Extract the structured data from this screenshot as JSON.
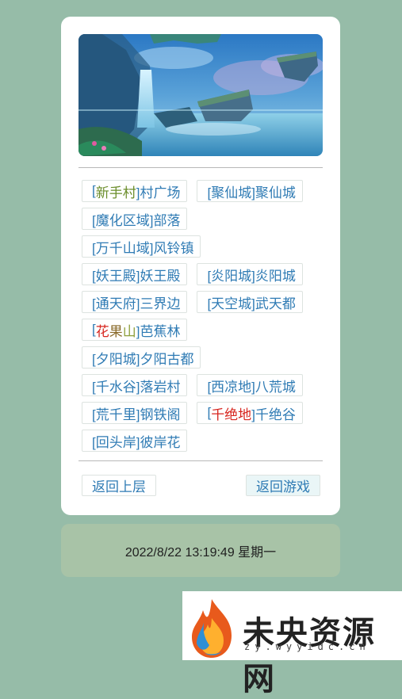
{
  "locations": [
    [
      {
        "id": "xinshoucun",
        "parts": [
          {
            "t": "[",
            "c": "bracket"
          },
          {
            "t": "新手村",
            "c": "c-green"
          },
          {
            "t": "]村广场",
            "c": "bracket"
          }
        ]
      },
      {
        "id": "juxiancheng",
        "parts": [
          {
            "t": "[聚仙城]聚仙城",
            "c": "bracket"
          }
        ]
      }
    ],
    [
      {
        "id": "mohuaquyu",
        "parts": [
          {
            "t": "[魔化区域]部落",
            "c": "bracket"
          }
        ]
      }
    ],
    [
      {
        "id": "wanqianshancheng",
        "parts": [
          {
            "t": "[万千山域]风铃镇",
            "c": "bracket"
          }
        ]
      }
    ],
    [
      {
        "id": "yaowangdian",
        "parts": [
          {
            "t": "[妖王殿]妖王殿",
            "c": "bracket"
          }
        ]
      },
      {
        "id": "yanyangcheng",
        "parts": [
          {
            "t": "[炎阳城]炎阳城",
            "c": "bracket"
          }
        ]
      }
    ],
    [
      {
        "id": "tongtianfu",
        "parts": [
          {
            "t": "[通天府]三界边",
            "c": "bracket"
          }
        ]
      },
      {
        "id": "tiankongcheng",
        "parts": [
          {
            "t": "[天空城]武天都",
            "c": "bracket"
          }
        ]
      }
    ],
    [
      {
        "id": "huaguoshan",
        "parts": [
          {
            "t": "[",
            "c": "bracket"
          },
          {
            "t": "花",
            "c": "c-red"
          },
          {
            "t": "果",
            "c": "c-brown"
          },
          {
            "t": "山",
            "c": "c-olive"
          },
          {
            "t": "]芭蕉林",
            "c": "bracket"
          }
        ]
      }
    ],
    [
      {
        "id": "xiyangcheng",
        "parts": [
          {
            "t": "[夕阳城]夕阳古都",
            "c": "bracket"
          }
        ]
      }
    ],
    [
      {
        "id": "qianshuigu",
        "parts": [
          {
            "t": "[千水谷]落岩村",
            "c": "bracket"
          }
        ]
      },
      {
        "id": "xiliangdi",
        "parts": [
          {
            "t": "[西凉地]八荒城",
            "c": "bracket"
          }
        ]
      }
    ],
    [
      {
        "id": "huangqianli",
        "parts": [
          {
            "t": "[荒千里]钢铁阁",
            "c": "bracket"
          }
        ]
      },
      {
        "id": "qianjuedi",
        "parts": [
          {
            "t": "[",
            "c": "bracket"
          },
          {
            "t": "千绝地",
            "c": "c-red"
          },
          {
            "t": "]千绝谷",
            "c": "bracket"
          }
        ]
      }
    ],
    [
      {
        "id": "huitouan",
        "parts": [
          {
            "t": "[回头岸]彼岸花",
            "c": "bracket"
          }
        ]
      }
    ]
  ],
  "nav": {
    "back_label": "返回上层",
    "game_label": "返回游戏"
  },
  "datetime": "2022/8/22 13:19:49 星期一",
  "watermark": {
    "title": "未央资源网",
    "subtitle": "zy.wyyidc.cn"
  },
  "colors": {
    "background": "#96bca8",
    "link": "#2f7bb4",
    "date_box": "#a8c3a7"
  },
  "banner_icon": "fantasy-landscape-image"
}
